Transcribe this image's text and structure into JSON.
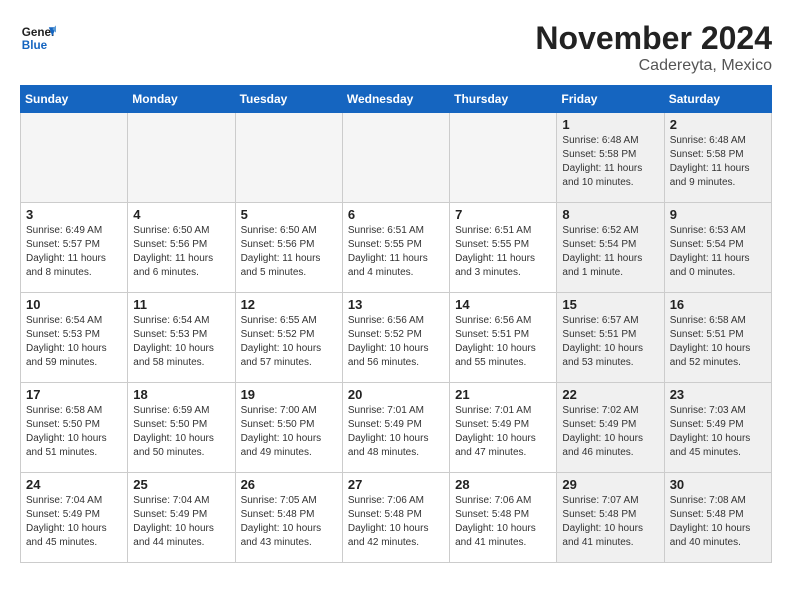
{
  "header": {
    "logo_line1": "General",
    "logo_line2": "Blue",
    "month": "November 2024",
    "location": "Cadereyta, Mexico"
  },
  "weekdays": [
    "Sunday",
    "Monday",
    "Tuesday",
    "Wednesday",
    "Thursday",
    "Friday",
    "Saturday"
  ],
  "weeks": [
    [
      {
        "day": "",
        "info": "",
        "empty": true
      },
      {
        "day": "",
        "info": "",
        "empty": true
      },
      {
        "day": "",
        "info": "",
        "empty": true
      },
      {
        "day": "",
        "info": "",
        "empty": true
      },
      {
        "day": "",
        "info": "",
        "empty": true
      },
      {
        "day": "1",
        "info": "Sunrise: 6:48 AM\nSunset: 5:58 PM\nDaylight: 11 hours\nand 10 minutes.",
        "shaded": true
      },
      {
        "day": "2",
        "info": "Sunrise: 6:48 AM\nSunset: 5:58 PM\nDaylight: 11 hours\nand 9 minutes.",
        "shaded": true
      }
    ],
    [
      {
        "day": "3",
        "info": "Sunrise: 6:49 AM\nSunset: 5:57 PM\nDaylight: 11 hours\nand 8 minutes."
      },
      {
        "day": "4",
        "info": "Sunrise: 6:50 AM\nSunset: 5:56 PM\nDaylight: 11 hours\nand 6 minutes."
      },
      {
        "day": "5",
        "info": "Sunrise: 6:50 AM\nSunset: 5:56 PM\nDaylight: 11 hours\nand 5 minutes."
      },
      {
        "day": "6",
        "info": "Sunrise: 6:51 AM\nSunset: 5:55 PM\nDaylight: 11 hours\nand 4 minutes."
      },
      {
        "day": "7",
        "info": "Sunrise: 6:51 AM\nSunset: 5:55 PM\nDaylight: 11 hours\nand 3 minutes."
      },
      {
        "day": "8",
        "info": "Sunrise: 6:52 AM\nSunset: 5:54 PM\nDaylight: 11 hours\nand 1 minute.",
        "shaded": true
      },
      {
        "day": "9",
        "info": "Sunrise: 6:53 AM\nSunset: 5:54 PM\nDaylight: 11 hours\nand 0 minutes.",
        "shaded": true
      }
    ],
    [
      {
        "day": "10",
        "info": "Sunrise: 6:54 AM\nSunset: 5:53 PM\nDaylight: 10 hours\nand 59 minutes."
      },
      {
        "day": "11",
        "info": "Sunrise: 6:54 AM\nSunset: 5:53 PM\nDaylight: 10 hours\nand 58 minutes."
      },
      {
        "day": "12",
        "info": "Sunrise: 6:55 AM\nSunset: 5:52 PM\nDaylight: 10 hours\nand 57 minutes."
      },
      {
        "day": "13",
        "info": "Sunrise: 6:56 AM\nSunset: 5:52 PM\nDaylight: 10 hours\nand 56 minutes."
      },
      {
        "day": "14",
        "info": "Sunrise: 6:56 AM\nSunset: 5:51 PM\nDaylight: 10 hours\nand 55 minutes."
      },
      {
        "day": "15",
        "info": "Sunrise: 6:57 AM\nSunset: 5:51 PM\nDaylight: 10 hours\nand 53 minutes.",
        "shaded": true
      },
      {
        "day": "16",
        "info": "Sunrise: 6:58 AM\nSunset: 5:51 PM\nDaylight: 10 hours\nand 52 minutes.",
        "shaded": true
      }
    ],
    [
      {
        "day": "17",
        "info": "Sunrise: 6:58 AM\nSunset: 5:50 PM\nDaylight: 10 hours\nand 51 minutes."
      },
      {
        "day": "18",
        "info": "Sunrise: 6:59 AM\nSunset: 5:50 PM\nDaylight: 10 hours\nand 50 minutes."
      },
      {
        "day": "19",
        "info": "Sunrise: 7:00 AM\nSunset: 5:50 PM\nDaylight: 10 hours\nand 49 minutes."
      },
      {
        "day": "20",
        "info": "Sunrise: 7:01 AM\nSunset: 5:49 PM\nDaylight: 10 hours\nand 48 minutes."
      },
      {
        "day": "21",
        "info": "Sunrise: 7:01 AM\nSunset: 5:49 PM\nDaylight: 10 hours\nand 47 minutes."
      },
      {
        "day": "22",
        "info": "Sunrise: 7:02 AM\nSunset: 5:49 PM\nDaylight: 10 hours\nand 46 minutes.",
        "shaded": true
      },
      {
        "day": "23",
        "info": "Sunrise: 7:03 AM\nSunset: 5:49 PM\nDaylight: 10 hours\nand 45 minutes.",
        "shaded": true
      }
    ],
    [
      {
        "day": "24",
        "info": "Sunrise: 7:04 AM\nSunset: 5:49 PM\nDaylight: 10 hours\nand 45 minutes."
      },
      {
        "day": "25",
        "info": "Sunrise: 7:04 AM\nSunset: 5:49 PM\nDaylight: 10 hours\nand 44 minutes."
      },
      {
        "day": "26",
        "info": "Sunrise: 7:05 AM\nSunset: 5:48 PM\nDaylight: 10 hours\nand 43 minutes."
      },
      {
        "day": "27",
        "info": "Sunrise: 7:06 AM\nSunset: 5:48 PM\nDaylight: 10 hours\nand 42 minutes."
      },
      {
        "day": "28",
        "info": "Sunrise: 7:06 AM\nSunset: 5:48 PM\nDaylight: 10 hours\nand 41 minutes."
      },
      {
        "day": "29",
        "info": "Sunrise: 7:07 AM\nSunset: 5:48 PM\nDaylight: 10 hours\nand 41 minutes.",
        "shaded": true
      },
      {
        "day": "30",
        "info": "Sunrise: 7:08 AM\nSunset: 5:48 PM\nDaylight: 10 hours\nand 40 minutes.",
        "shaded": true
      }
    ]
  ]
}
